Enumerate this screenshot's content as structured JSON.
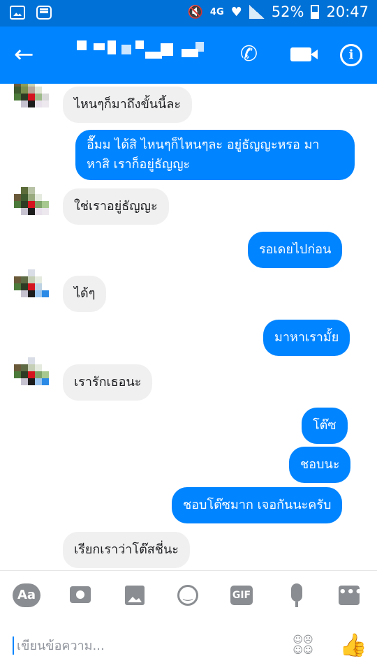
{
  "status_bar": {
    "network": "4G",
    "battery": "52%",
    "time": "20:47"
  },
  "header": {
    "back_icon": "arrow-left-icon",
    "call_icon": "phone-icon",
    "video_icon": "video-camera-icon",
    "info_icon": "info-icon"
  },
  "messages": [
    {
      "side": "in",
      "text": "ไหนๆก็มาถึงขั้นนี้ละ"
    },
    {
      "side": "out",
      "text": "อื๊มม ได้สิ ไหนๆก็ไหนๆละ อยู่ธัญญะหรอ มา\nหาสิ เราก็อยู่ธัญญะ"
    },
    {
      "side": "in",
      "text": "ใช่เราอยู่ธัญญะ"
    },
    {
      "side": "out",
      "text": "รอเดยไปก่อน"
    },
    {
      "side": "in",
      "text": "ได้ๆ"
    },
    {
      "side": "out",
      "text": "มาหาเรามั้ย"
    },
    {
      "side": "in",
      "text": "เรารักเธอนะ"
    },
    {
      "side": "out",
      "text": "โต๊ซ"
    },
    {
      "side": "out",
      "text": "ชอบนะ"
    },
    {
      "side": "out",
      "text": "ชอบโต๊ซมาก เจอกันนะครับ"
    },
    {
      "side": "in",
      "text": "เรียกเราว่าโต๊สชี่นะ"
    }
  ],
  "composer": {
    "aa_label": "Aa",
    "gif_label": "GIF",
    "placeholder": "เขียนข้อความ...",
    "icons": [
      "aa-icon",
      "camera-icon",
      "image-icon",
      "emoji-icon",
      "gif-icon",
      "mic-icon",
      "more-icon",
      "reactions-icon",
      "like-icon"
    ]
  },
  "colors": {
    "statusbar": "#0071d6",
    "header": "#0084ff",
    "outgoing_bubble": "#0084ff",
    "incoming_bubble": "#f1f0f0",
    "icon_gray": "#8a8d91"
  }
}
